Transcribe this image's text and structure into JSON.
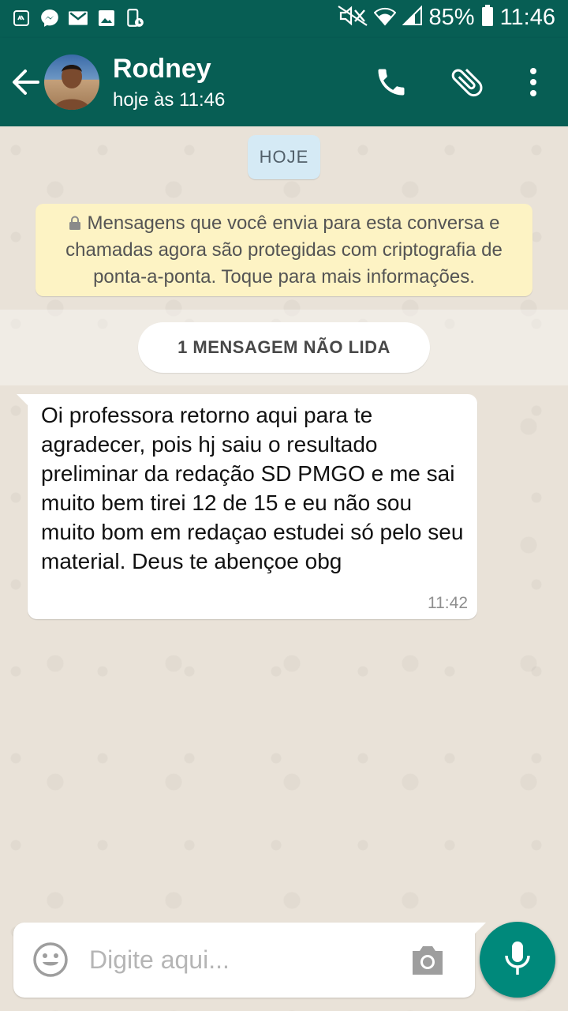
{
  "status_bar": {
    "battery_percent": "85%",
    "time": "11:46",
    "notification_icons": [
      "recycle-icon",
      "messenger-icon",
      "gmail-icon",
      "image-icon",
      "phone-clock-icon"
    ],
    "system_icons": [
      "mute-icon",
      "wifi-icon",
      "signal-icon",
      "battery-icon"
    ]
  },
  "header": {
    "contact_name": "Rodney",
    "last_seen": "hoje às 11:46",
    "actions": [
      "phone-icon",
      "paperclip-icon",
      "more-vert-icon"
    ]
  },
  "chat": {
    "date_label": "HOJE",
    "encryption_notice": "Mensagens que você envia para esta conversa e chamadas agora são protegidas com criptografia de ponta-a-ponta. Toque para mais informações.",
    "unread_label": "1 MENSAGEM NÃO LIDA",
    "messages": [
      {
        "text": "Oi professora retorno aqui para te agradecer, pois hj saiu o resultado preliminar da redação SD PMGO e me sai muito bem tirei 12 de 15 e eu não sou muito bom em redaçao estudei só pelo seu material. Deus te abençoe obg",
        "time": "11:42",
        "direction": "incoming"
      }
    ]
  },
  "composer": {
    "placeholder": "Digite aqui..."
  },
  "colors": {
    "header": "#075e54",
    "accent": "#00897b",
    "chat_background": "#e9e2d8",
    "encryption_notice_bg": "#fdf3c4",
    "date_chip_bg": "#d5eaf5"
  }
}
